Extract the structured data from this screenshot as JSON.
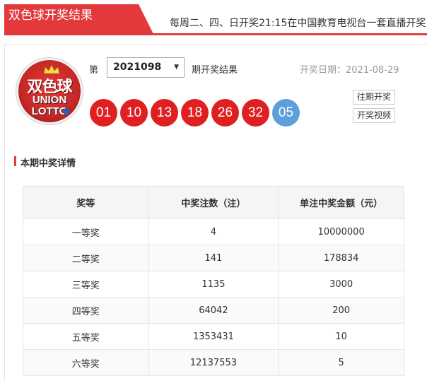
{
  "header": {
    "title": "双色球开奖结果",
    "broadcast": "每周二、四、日开奖21:15在中国教育电视台一套直播开奖"
  },
  "logo": {
    "text_cn": "双色球",
    "text_en1": "UNION",
    "text_en2": "LOTTO"
  },
  "draw": {
    "prefix": "第",
    "issue": "2021098",
    "suffix": "期开奖结果",
    "date": "开奖日期：2021-08-29",
    "red_balls": [
      "01",
      "10",
      "13",
      "18",
      "26",
      "32"
    ],
    "blue_ball": "05"
  },
  "actions": {
    "history": "往期开奖",
    "video": "开奖视频"
  },
  "section": {
    "title": "本期中奖详情"
  },
  "table": {
    "headers": [
      "奖等",
      "中奖注数（注）",
      "单注中奖金额（元）"
    ],
    "rows": [
      [
        "一等奖",
        "4",
        "10000000"
      ],
      [
        "二等奖",
        "141",
        "178834"
      ],
      [
        "三等奖",
        "1135",
        "3000"
      ],
      [
        "四等奖",
        "64042",
        "200"
      ],
      [
        "五等奖",
        "1353431",
        "10"
      ],
      [
        "六等奖",
        "12137553",
        "5"
      ]
    ]
  },
  "colors": {
    "brand_red": "#e4393c",
    "ball_red": "#e02020",
    "ball_blue": "#5b9fdc"
  }
}
